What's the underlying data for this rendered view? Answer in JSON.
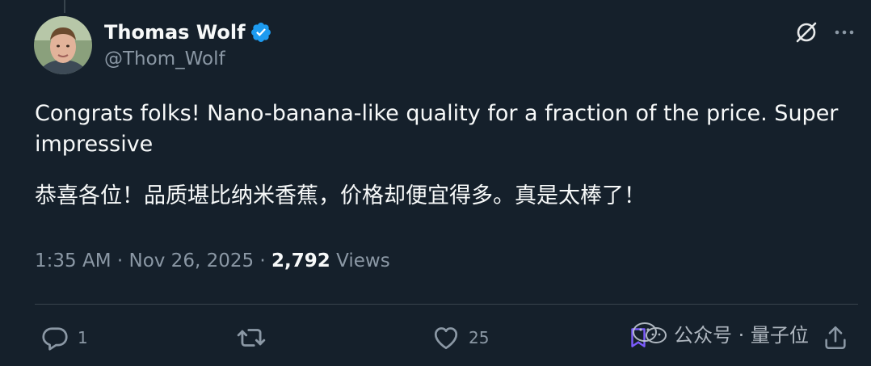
{
  "author": {
    "display_name": "Thomas Wolf",
    "handle": "@Thom_Wolf",
    "verified": true
  },
  "tweet": {
    "text_en": "Congrats folks! Nano-banana-like quality for a fraction of the price. Super impressive",
    "text_zh": "恭喜各位！品质堪比纳米香蕉，价格却便宜得多。真是太棒了！"
  },
  "meta": {
    "time": "1:35 AM",
    "separator": "·",
    "date": "Nov 26, 2025",
    "views_count": "2,792",
    "views_label": "Views"
  },
  "actions": {
    "replies": "1",
    "retweets": "",
    "likes": "25"
  },
  "watermark": {
    "text": "公众号 · 量子位"
  },
  "colors": {
    "background": "#15202b",
    "text_primary": "#f7f9f9",
    "text_secondary": "#8b98a5",
    "verified_blue": "#1d9bf0",
    "divider": "#38444d"
  },
  "icons": {
    "grok": "grok-icon",
    "more": "more-icon",
    "reply": "reply-icon",
    "retweet": "retweet-icon",
    "like": "heart-icon",
    "bookmark": "bookmark-icon",
    "share": "share-icon",
    "verified": "verified-badge-icon"
  }
}
